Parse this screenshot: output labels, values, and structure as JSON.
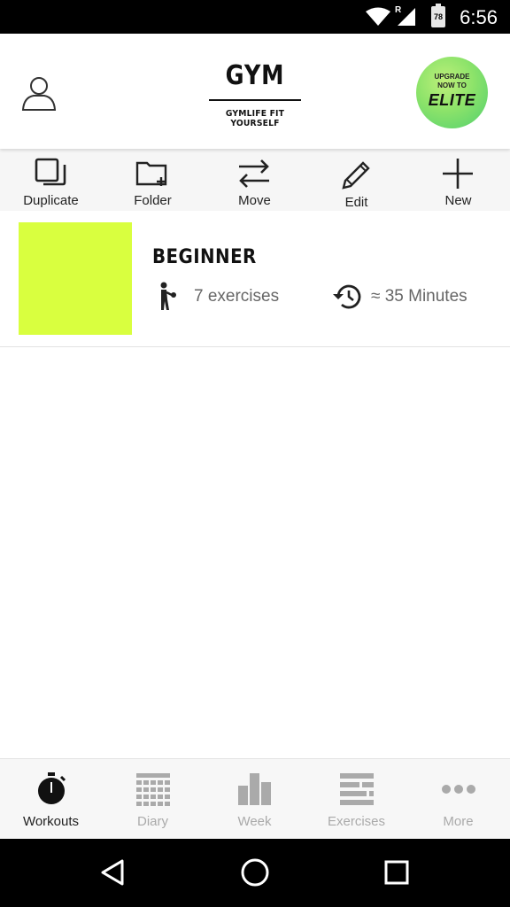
{
  "status_bar": {
    "time": "6:56",
    "battery_level": "78",
    "network_label": "R"
  },
  "header": {
    "title": "GYM",
    "tagline": "GYMLIFE FIT YOURSELF",
    "upgrade": {
      "line1": "UPGRADE",
      "line2": "NOW TO",
      "line3": "ELITE"
    }
  },
  "toolbar": [
    {
      "label": "Duplicate",
      "icon": "duplicate-icon"
    },
    {
      "label": "Folder",
      "icon": "folder-add-icon"
    },
    {
      "label": "Move",
      "icon": "move-arrows-icon"
    },
    {
      "label": "Edit",
      "icon": "pencil-icon"
    },
    {
      "label": "New",
      "icon": "plus-icon"
    }
  ],
  "workouts": [
    {
      "name": "BEGINNER",
      "exercises": "7 exercises",
      "duration": "≈ 35 Minutes",
      "thumb_color": "#d9ff3f"
    }
  ],
  "bottom_nav": [
    {
      "label": "Workouts",
      "icon": "stopwatch-icon",
      "active": true
    },
    {
      "label": "Diary",
      "icon": "calendar-grid-icon",
      "active": false
    },
    {
      "label": "Week",
      "icon": "bar-chart-icon",
      "active": false
    },
    {
      "label": "Exercises",
      "icon": "list-bars-icon",
      "active": false
    },
    {
      "label": "More",
      "icon": "more-dots-icon",
      "active": false
    }
  ],
  "system_nav": [
    "back-icon",
    "home-icon",
    "recents-icon"
  ],
  "colors": {
    "accent": "#d9ff3f",
    "badge_green": "#6fd96c",
    "inactive": "#aaaaaa"
  }
}
